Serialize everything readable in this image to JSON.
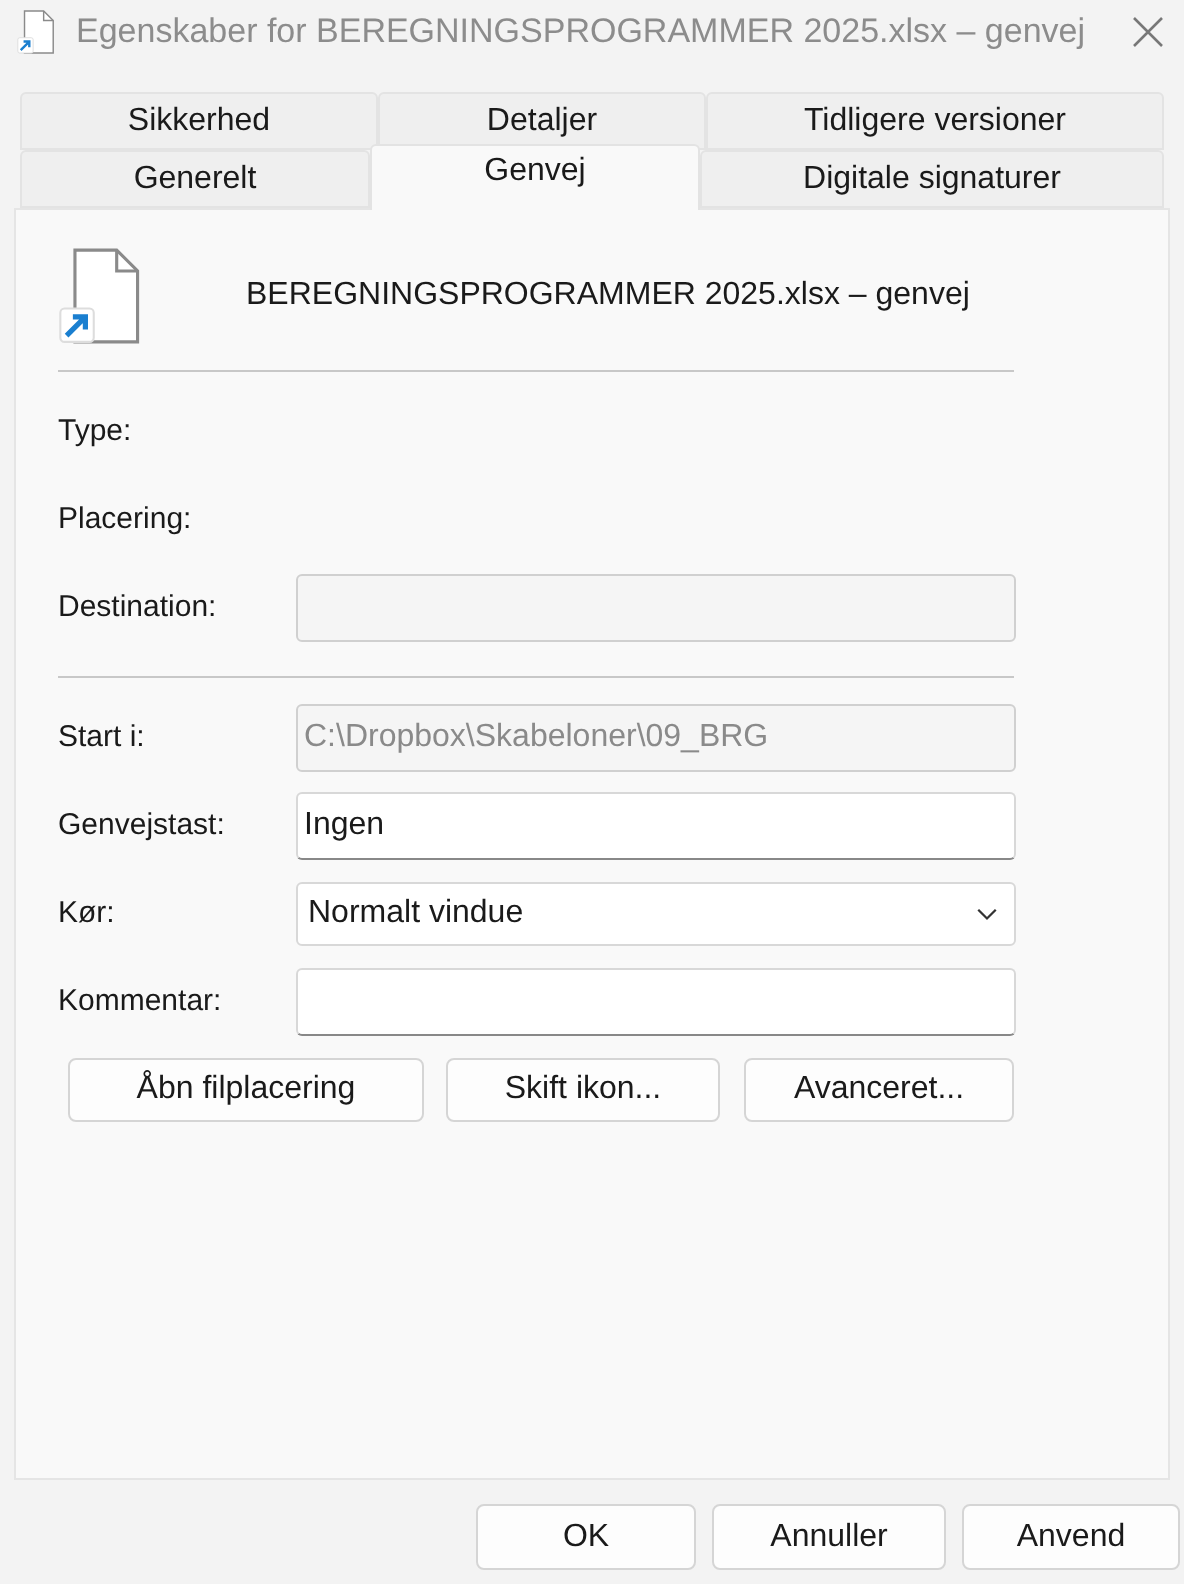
{
  "window": {
    "title": "Egenskaber for BEREGNINGSPROGRAMMER 2025.xlsx – genvej"
  },
  "tab_rows": [
    {
      "tabs": [
        {
          "label": "Sikkerhed",
          "selected": false
        },
        {
          "label": "Detaljer",
          "selected": false
        },
        {
          "label": "Tidligere versioner",
          "selected": false
        }
      ]
    },
    {
      "tabs": [
        {
          "label": "Generelt",
          "selected": false
        },
        {
          "label": "Genvej",
          "selected": true
        },
        {
          "label": "Digitale signaturer",
          "selected": false
        }
      ]
    }
  ],
  "header": {
    "name": "BEREGNINGSPROGRAMMER 2025.xlsx – genvej"
  },
  "sections": [
    {
      "rows": [
        {
          "kind": "info",
          "label": "Type:"
        },
        {
          "kind": "info",
          "label": "Placering:"
        },
        {
          "kind": "text",
          "label": "Destination:",
          "disabled": true
        }
      ]
    },
    {
      "rows": [
        {
          "kind": "text",
          "label": "Start i:",
          "value": "C:\\Dropbox\\Skabeloner\\09_BRG",
          "disabled": true
        },
        {
          "kind": "text",
          "label": "Genvejstast:",
          "value": "Ingen",
          "disabled": false
        },
        {
          "kind": "dropdown",
          "label": "Kør:",
          "value": "Normalt vindue"
        },
        {
          "kind": "text",
          "label": "Kommentar:",
          "disabled": false
        }
      ]
    }
  ],
  "actions": [
    "Åbn filplacering",
    "Skift ikon...",
    "Avanceret..."
  ],
  "buttons": [
    "OK",
    "Annuller",
    "Anvend"
  ]
}
